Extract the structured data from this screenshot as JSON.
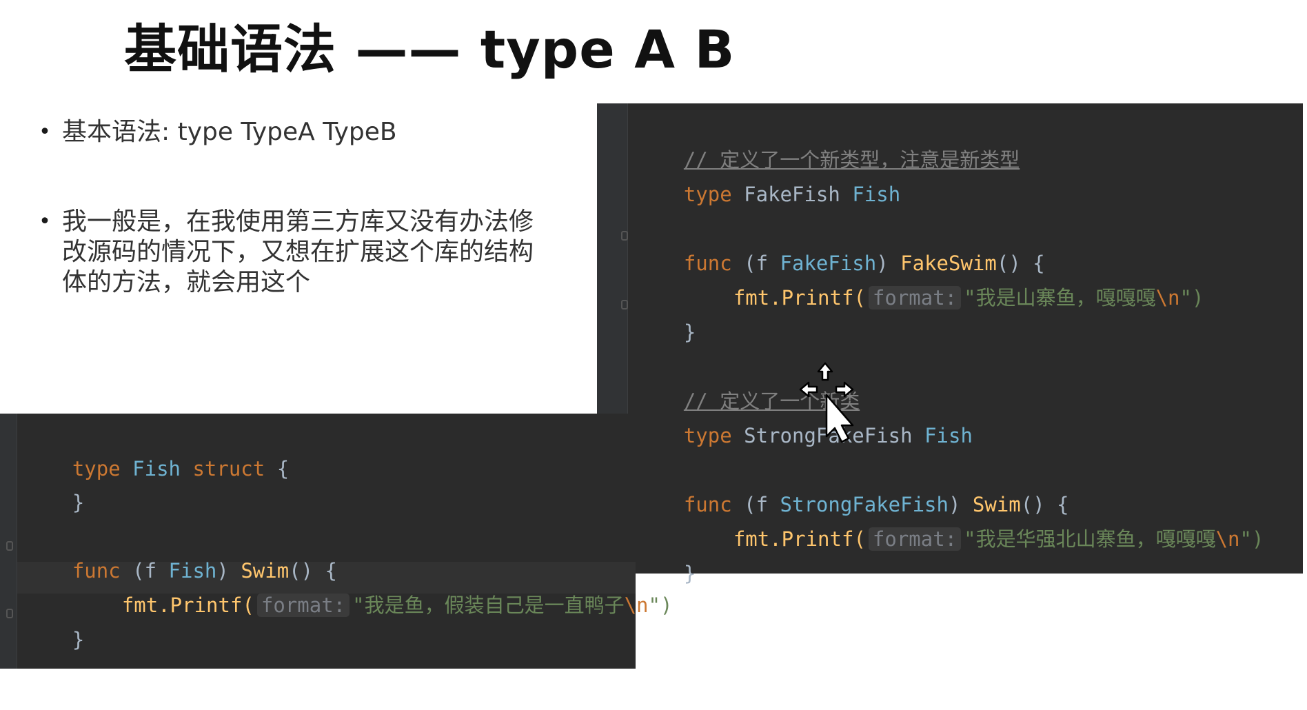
{
  "slide": {
    "title": "基础语法 —— type A B"
  },
  "bullets": [
    {
      "marker": "•",
      "text": "基本语法: type TypeA TypeB"
    },
    {
      "marker": "•",
      "text": "我一般是，在我使用第三方库又没有办法修改源码的情况下，又想在扩展这个库的结构体的方法，就会用这个"
    }
  ],
  "code_right": {
    "comment1": "// 定义了一个新类型，注意是新类型",
    "line2": {
      "kw": "type",
      "name": "FakeFish",
      "base": "Fish"
    },
    "line3": {
      "kw": "func",
      "open": "(f",
      "recv": "FakeFish",
      "close": ")",
      "method": "FakeSwim",
      "sig": "() {"
    },
    "line4": {
      "call": "fmt.Printf(",
      "hint": "format:",
      "str": "\"我是山寨鱼，嘎嘎嘎",
      "esc": "\\n",
      "end": "\")"
    },
    "line5": "}",
    "comment2": "// 定义了一个新类",
    "line7": {
      "kw": "type",
      "name": "StrongFakeFish",
      "base": "Fish"
    },
    "line8": {
      "kw": "func",
      "open": "(f",
      "recv": "StrongFakeFish",
      "close": ")",
      "method": "Swim",
      "sig": "() {"
    },
    "line9": {
      "call": "fmt.Printf(",
      "hint": "format:",
      "str": "\"我是华强北山寨鱼，嘎嘎嘎",
      "esc": "\\n",
      "end": "\")"
    },
    "line10": "}"
  },
  "code_left": {
    "line1": {
      "kw": "type",
      "name": "Fish",
      "kw2": "struct",
      "brace": "{"
    },
    "line2": "}",
    "line3": {
      "kw": "func",
      "open": "(f",
      "recv": "Fish",
      "close": ")",
      "method": "Swim",
      "sig": "() {"
    },
    "line4": {
      "call": "fmt.Printf(",
      "hint": "format:",
      "str": "\"我是鱼，假装自己是一直鸭子",
      "esc": "\\n",
      "end": "\")"
    },
    "line5": "}"
  },
  "colors": {
    "editor_bg": "#2b2b2b",
    "keyword": "#cc7832",
    "type_name": "#6fb3d2",
    "function_name": "#ffc66d",
    "string": "#6a8759",
    "comment": "#808080"
  },
  "icons": {
    "cursor": "move-cursor-icon"
  }
}
